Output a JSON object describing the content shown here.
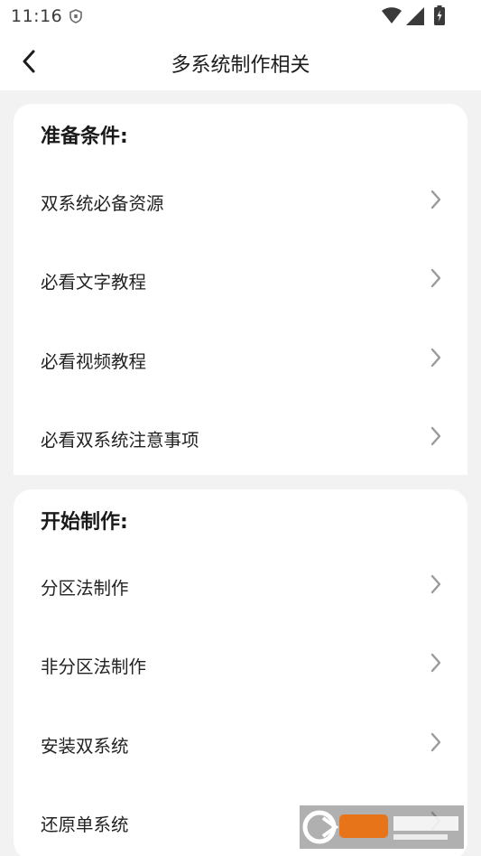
{
  "status_bar": {
    "time": "11:16",
    "icons": [
      "shield-icon",
      "wifi-icon",
      "signal-icon",
      "battery-icon"
    ]
  },
  "app_bar": {
    "back_icon": "chevron-left-icon",
    "title": "多系统制作相关"
  },
  "sections": [
    {
      "title": "准备条件:",
      "items": [
        {
          "label": "双系统必备资源"
        },
        {
          "label": "必看文字教程"
        },
        {
          "label": "必看视频教程"
        },
        {
          "label": "必看双系统注意事项"
        }
      ]
    },
    {
      "title": "开始制作:",
      "items": [
        {
          "label": "分区法制作"
        },
        {
          "label": "非分区法制作"
        },
        {
          "label": "安装双系统"
        },
        {
          "label": "还原单系统"
        }
      ]
    }
  ],
  "colors": {
    "background": "#f2f2f2",
    "card": "#ffffff",
    "text": "#222222",
    "chevron": "#9a9a9a"
  }
}
